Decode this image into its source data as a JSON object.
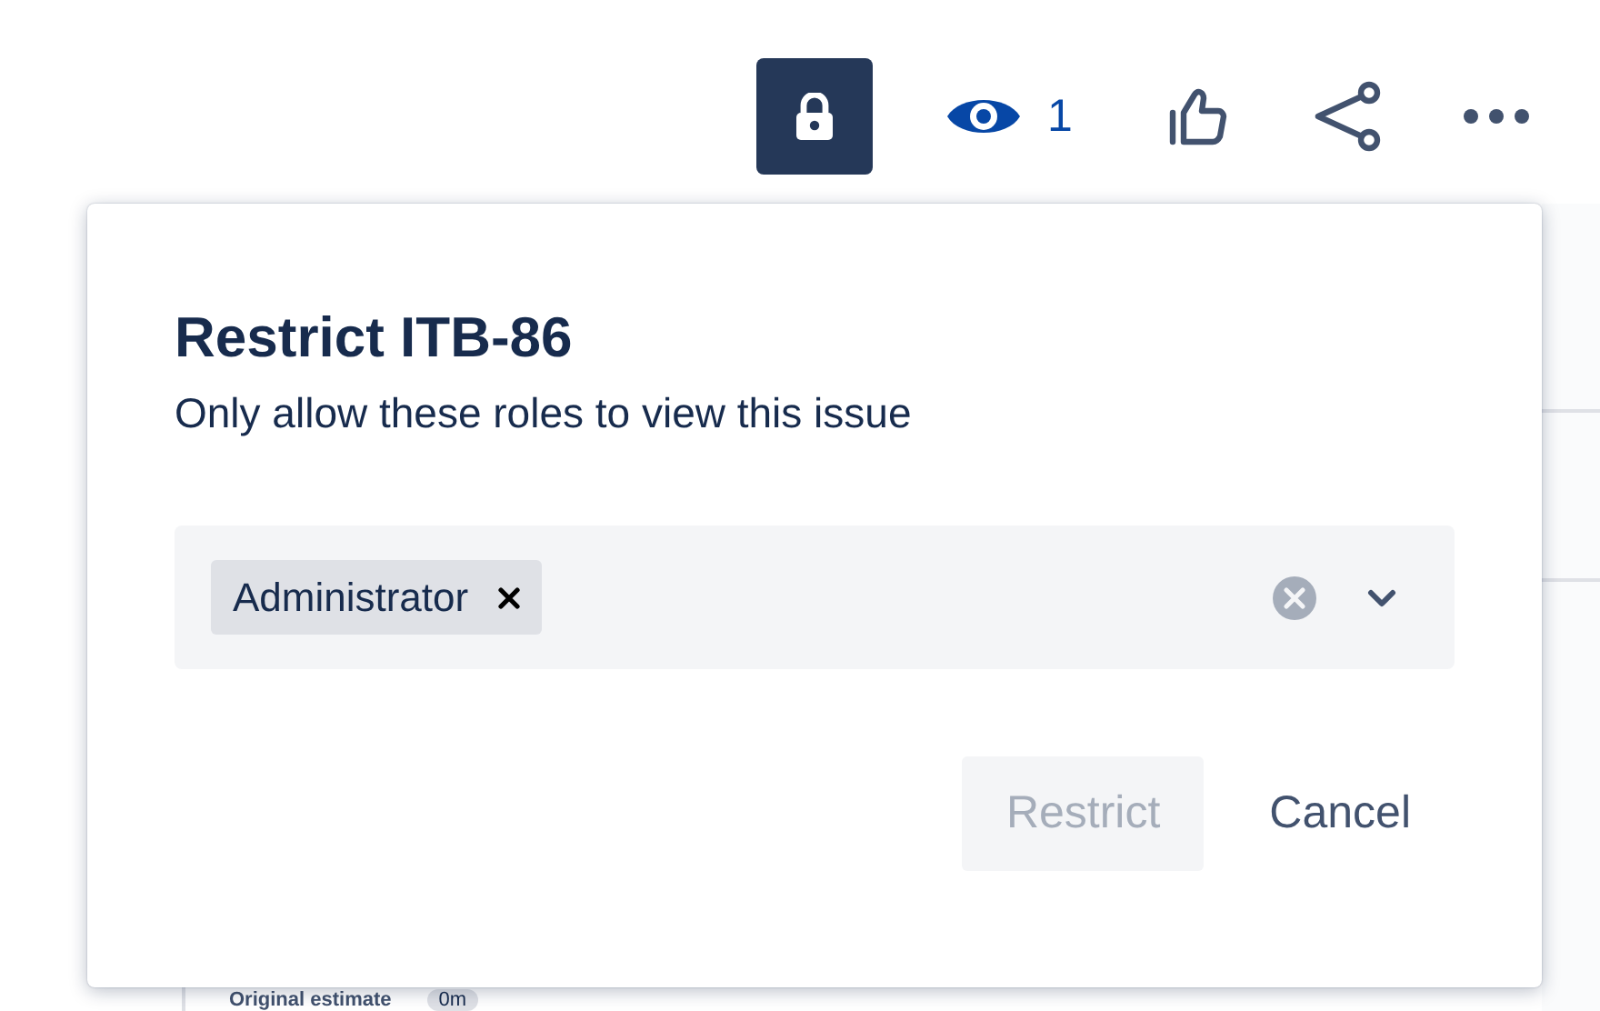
{
  "toolbar": {
    "restrict_button": {
      "selected": true
    },
    "watchers": {
      "count": "1"
    }
  },
  "dialog": {
    "title": "Restrict ITB-86",
    "subtitle": "Only allow these roles to view this issue",
    "roles_field": {
      "tags": [
        {
          "label": "Administrator"
        }
      ]
    },
    "buttons": [
      {
        "label": "Restrict",
        "disabled": true
      },
      {
        "label": "Cancel",
        "disabled": false
      }
    ]
  },
  "details": [
    {
      "label": "Original estimate",
      "value": "0m"
    }
  ]
}
